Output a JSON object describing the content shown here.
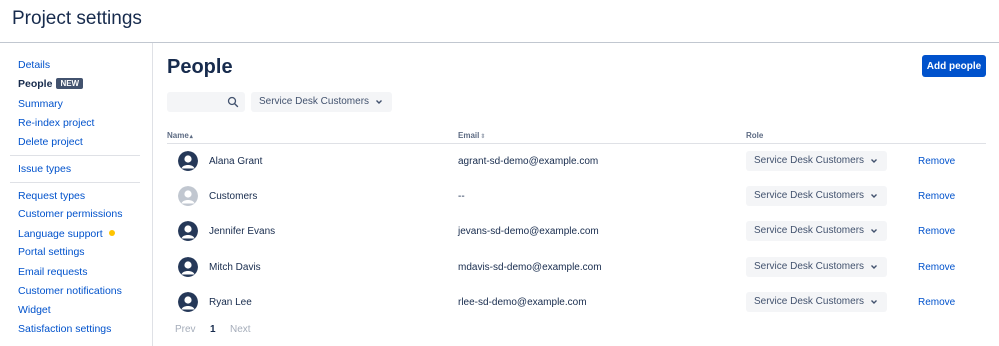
{
  "header": {
    "title": "Project settings"
  },
  "sidebar": {
    "items": [
      {
        "label": "Details"
      },
      {
        "label": "People",
        "badge": "NEW",
        "active": true
      },
      {
        "label": "Summary"
      },
      {
        "label": "Re-index project"
      },
      {
        "label": "Delete project"
      },
      {
        "label": "Issue types"
      },
      {
        "label": "Request types"
      },
      {
        "label": "Customer permissions"
      },
      {
        "label": "Language support",
        "status_dot_color": "#ffc400"
      },
      {
        "label": "Portal settings"
      },
      {
        "label": "Email requests"
      },
      {
        "label": "Customer notifications"
      },
      {
        "label": "Widget"
      },
      {
        "label": "Satisfaction settings"
      }
    ]
  },
  "main": {
    "title": "People",
    "add_button": "Add people",
    "search": {
      "value": "",
      "placeholder": ""
    },
    "role_filter": "Service Desk Customers",
    "columns": {
      "name": "Name",
      "name_sort": "▴",
      "email": "Email",
      "email_sort": "⇕",
      "role": "Role"
    },
    "rows": [
      {
        "name": "Alana Grant",
        "email": "agrant-sd-demo@example.com",
        "role": "Service Desk Customers",
        "action": "Remove",
        "avatar": "user-avatar"
      },
      {
        "name": "Customers",
        "email": "--",
        "role": "Service Desk Customers",
        "action": "Remove",
        "avatar": "group-avatar"
      },
      {
        "name": "Jennifer Evans",
        "email": "jevans-sd-demo@example.com",
        "role": "Service Desk Customers",
        "action": "Remove",
        "avatar": "user-avatar"
      },
      {
        "name": "Mitch Davis",
        "email": "mdavis-sd-demo@example.com",
        "role": "Service Desk Customers",
        "action": "Remove",
        "avatar": "user-avatar"
      },
      {
        "name": "Ryan Lee",
        "email": "rlee-sd-demo@example.com",
        "role": "Service Desk Customers",
        "action": "Remove",
        "avatar": "user-avatar"
      }
    ],
    "pagination": {
      "prev": "Prev",
      "current": "1",
      "next": "Next"
    }
  },
  "colors": {
    "primary": "#0052cc",
    "text": "#172b4d",
    "badge": "#42526e",
    "status_dot": "#ffc400"
  }
}
